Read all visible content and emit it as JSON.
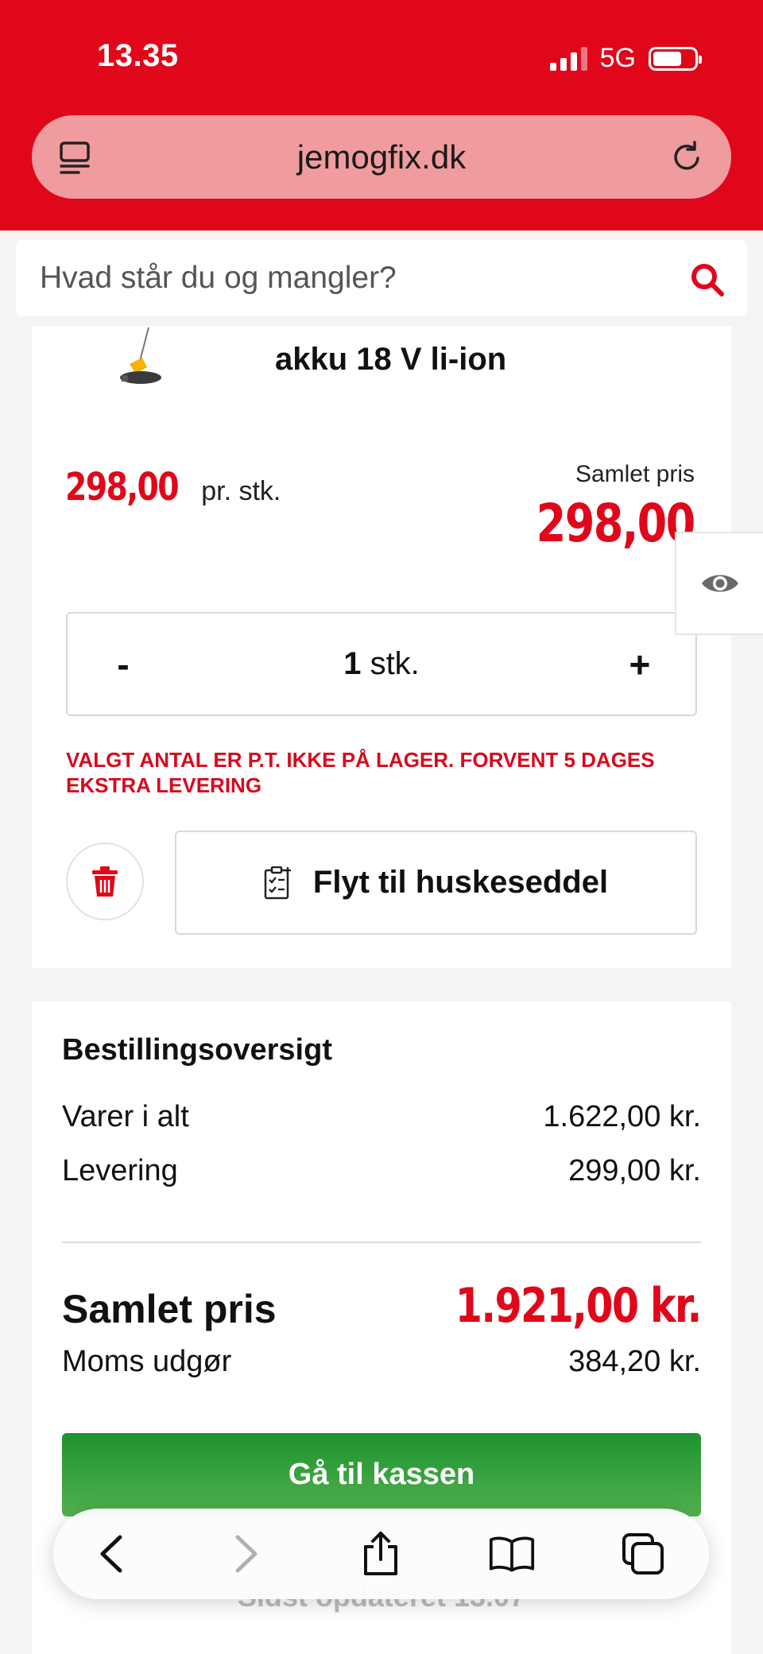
{
  "status": {
    "time": "13.35",
    "network": "5G"
  },
  "browser": {
    "url": "jemogfix.dk"
  },
  "search": {
    "placeholder": "Hvad står du og mangler?"
  },
  "product": {
    "title": "akku 18 V li-ion",
    "unit_price": "298,00",
    "unit_suffix": "pr. stk.",
    "total_label": "Samlet pris",
    "total_price": "298,00",
    "quantity": "1",
    "quantity_unit": "stk.",
    "decrease_label": "-",
    "increase_label": "+",
    "stock_warning": "VALGT ANTAL ER P.T. IKKE PÅ LAGER. FORVENT 5 DAGES EKSTRA LEVERING",
    "wishlist_label": "Flyt til huskeseddel"
  },
  "summary": {
    "title": "Bestillingsoversigt",
    "items_label": "Varer i alt",
    "items_value": "1.622,00 kr.",
    "delivery_label": "Levering",
    "delivery_value": "299,00 kr.",
    "total_label": "Samlet pris",
    "total_value": "1.921,00 kr.",
    "vat_label": "Moms udgør",
    "vat_value": "384,20 kr.",
    "checkout_label": "Gå til kassen",
    "updated_text": "Sidst opdateret 13.07"
  },
  "colors": {
    "brand_red": "#e0071a",
    "checkout_green": "#1e922f"
  },
  "icons": {
    "url_left": "reader-icon",
    "url_right": "reload-icon",
    "search": "search-icon",
    "visibility": "eye-icon",
    "delete": "trash-icon",
    "wishlist": "checklist-icon",
    "toolbar": [
      "back-icon",
      "forward-icon",
      "share-icon",
      "bookmarks-icon",
      "tabs-icon"
    ]
  }
}
